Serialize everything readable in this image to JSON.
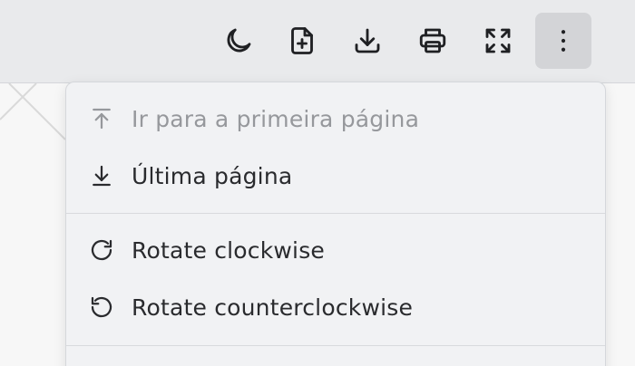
{
  "toolbar": {
    "buttons": [
      {
        "icon": "moon-icon"
      },
      {
        "icon": "file-plus-icon"
      },
      {
        "icon": "download-icon"
      },
      {
        "icon": "printer-icon"
      },
      {
        "icon": "fullscreen-icon"
      },
      {
        "icon": "more-vertical-icon"
      }
    ]
  },
  "menu": {
    "first_page_label": "Ir para a primeira página",
    "last_page_label": "Última página",
    "rotate_cw_label": "Rotate clockwise",
    "rotate_ccw_label": "Rotate counterclockwise"
  },
  "colors": {
    "toolbar_bg": "#e9eaec",
    "menu_bg": "#f1f2f4",
    "text": "#2a2b2e",
    "disabled_text": "#96989c"
  }
}
